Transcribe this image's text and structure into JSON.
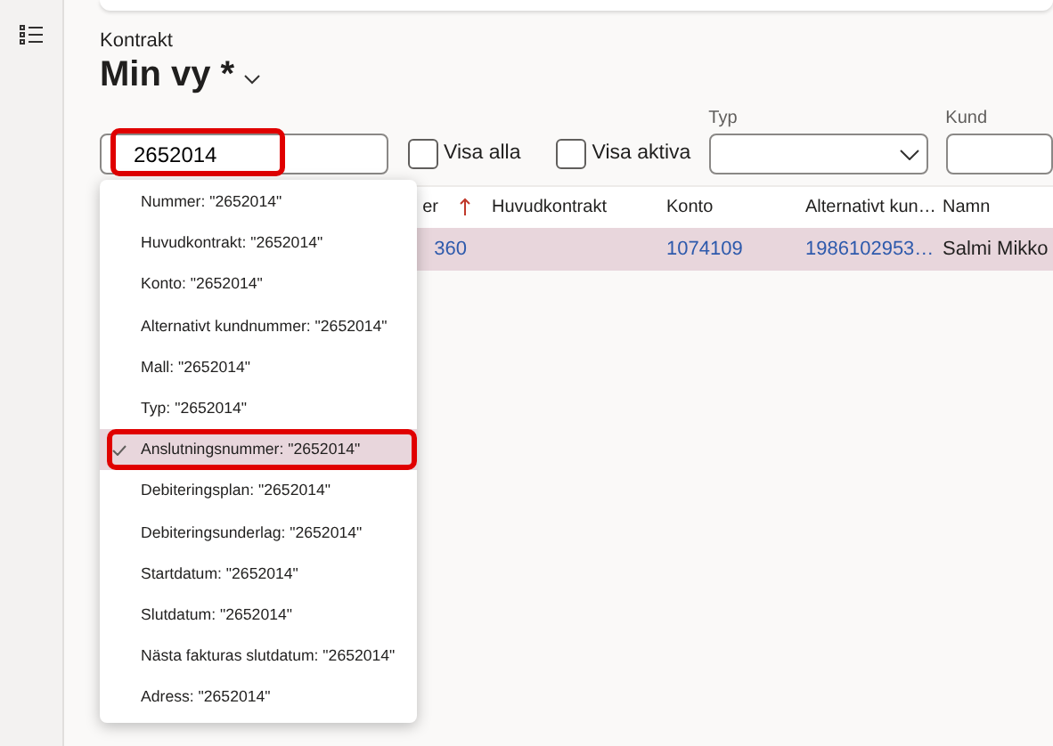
{
  "breadcrumb": "Kontrakt",
  "view": {
    "title": "Min vy *"
  },
  "search": {
    "value": "2652014",
    "highlighted": true
  },
  "checkboxes": [
    {
      "label": "Visa alla",
      "checked": false
    },
    {
      "label": "Visa aktiva",
      "checked": false
    }
  ],
  "filters": [
    {
      "label": "Typ",
      "kind": "select"
    },
    {
      "label": "Kund",
      "kind": "text"
    }
  ],
  "table": {
    "columns": [
      {
        "label": "er",
        "sorted": true
      },
      {
        "label": "Huvudkontrakt",
        "sorted": false
      },
      {
        "label": "Konto",
        "sorted": false
      },
      {
        "label": "Alternativt kun…",
        "sorted": false
      },
      {
        "label": "Namn",
        "sorted": false
      }
    ],
    "rows": [
      {
        "selected": true,
        "column_1": {
          "text": "360",
          "link": true
        },
        "konto": {
          "text": "1074109",
          "link": true
        },
        "alternativt_kun": {
          "text": "1986102953…",
          "link": true
        },
        "namn": {
          "text": "Salmi Mikko",
          "link": false
        }
      }
    ]
  },
  "dropdown": {
    "items": [
      {
        "label": "Nummer: \"2652014\"",
        "selected": false,
        "highlighted": false
      },
      {
        "label": "Huvudkontrakt: \"2652014\"",
        "selected": false,
        "highlighted": false
      },
      {
        "label": "Konto: \"2652014\"",
        "selected": false,
        "highlighted": false
      },
      {
        "label": "Alternativt kundnummer: \"2652014\"",
        "selected": false,
        "highlighted": false
      },
      {
        "label": "Mall: \"2652014\"",
        "selected": false,
        "highlighted": false
      },
      {
        "label": "Typ: \"2652014\"",
        "selected": false,
        "highlighted": false
      },
      {
        "label": "Anslutningsnummer: \"2652014\"",
        "selected": true,
        "highlighted": true
      },
      {
        "label": "Debiteringsplan: \"2652014\"",
        "selected": false,
        "highlighted": false
      },
      {
        "label": "Debiteringsunderlag: \"2652014\"",
        "selected": false,
        "highlighted": false
      },
      {
        "label": "Startdatum: \"2652014\"",
        "selected": false,
        "highlighted": false
      },
      {
        "label": "Slutdatum: \"2652014\"",
        "selected": false,
        "highlighted": false
      },
      {
        "label": "Nästa fakturas slutdatum: \"2652014\"",
        "selected": false,
        "highlighted": false
      },
      {
        "label": "Adress: \"2652014\"",
        "selected": false,
        "highlighted": false
      }
    ]
  }
}
